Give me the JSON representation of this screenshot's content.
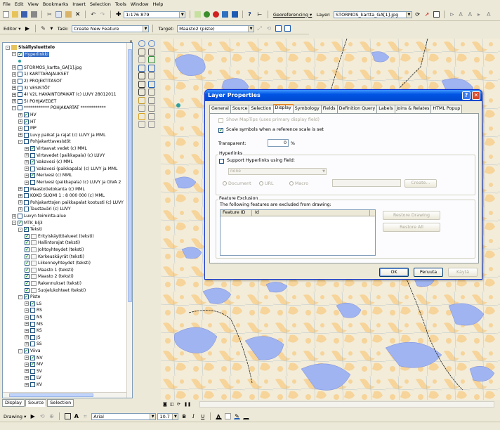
{
  "menu": [
    "File",
    "Edit",
    "View",
    "Bookmarks",
    "Insert",
    "Selection",
    "Tools",
    "Window",
    "Help"
  ],
  "toolbar1": {
    "scale_value": "1:176 879",
    "georeferencing_label": "Georeferencing ▾",
    "layer_label": "Layer:",
    "layer_value": "STORMOS_kartta_GA[1].jpg"
  },
  "editor_bar": {
    "editor_label": "Editor ▾",
    "task_label": "Task:",
    "task_value": "Create New Feature",
    "target_label": "Target:",
    "target_value": "Maasto2 (piste)"
  },
  "toc": {
    "items": [
      {
        "label": "Sisällysluettelo",
        "level": 0,
        "exp": "-",
        "chk": null,
        "bold": true
      },
      {
        "label": "Hyperlinkki",
        "level": 1,
        "exp": "-",
        "chk": true,
        "selected": true
      },
      {
        "label": "",
        "level": 2,
        "exp": null,
        "chk": null
      },
      {
        "label": "STORMOS_kartta_GA[1].jpg",
        "level": 1,
        "exp": "+",
        "chk": false
      },
      {
        "label": "1) KARTTARAJAUKSET",
        "level": 1,
        "exp": "+",
        "chk": false
      },
      {
        "label": "2) PROJEKTITASOT",
        "level": 1,
        "exp": "+",
        "chk": false
      },
      {
        "label": "3) VESISTÖT",
        "level": 1,
        "exp": "+",
        "chk": false
      },
      {
        "label": "4) V2L HAVAINTOPAIKAT (c) LUVY 28012011",
        "level": 1,
        "exp": "+",
        "chk": false
      },
      {
        "label": "5) POHJAVEDET",
        "level": 1,
        "exp": "+",
        "chk": false
      },
      {
        "label": "************ POHJAKARTAT ************",
        "level": 1,
        "exp": "-",
        "chk": false
      },
      {
        "label": "HV",
        "level": 2,
        "exp": "+",
        "chk": true
      },
      {
        "label": "HT",
        "level": 2,
        "exp": "+",
        "chk": true
      },
      {
        "label": "MP",
        "level": 2,
        "exp": "+",
        "chk": false
      },
      {
        "label": "Luvy paikat ja rajat (c) LUVY ja MML",
        "level": 2,
        "exp": "+",
        "chk": false
      },
      {
        "label": "Pohjakarttavesistöt",
        "level": 2,
        "exp": "-",
        "chk": false
      },
      {
        "label": "Virtaavat vedet (c) MML",
        "level": 3,
        "exp": "+",
        "chk": true
      },
      {
        "label": "Virtavedet (paikkapala) (c) LUVY",
        "level": 3,
        "exp": "+",
        "chk": false
      },
      {
        "label": "Vakavesi (c) MML",
        "level": 3,
        "exp": "+",
        "chk": true
      },
      {
        "label": "Vakavesi (paikkapala) (c) LUVY ja MML",
        "level": 3,
        "exp": "+",
        "chk": false
      },
      {
        "label": "Merivesi (c) MML",
        "level": 3,
        "exp": "+",
        "chk": true
      },
      {
        "label": "Merivesi (paikkapala) (c) LUVY ja OIVA 2",
        "level": 3,
        "exp": "+",
        "chk": false
      },
      {
        "label": "Maastotietokanta (c) MML",
        "level": 2,
        "exp": "+",
        "chk": false
      },
      {
        "label": "KOKO SUOMI 1 : 8 000 000 (c) MML",
        "level": 2,
        "exp": "+",
        "chk": false
      },
      {
        "label": "Pohjakarttojen paikkapalat kootusti (c) LUVY",
        "level": 2,
        "exp": "+",
        "chk": false
      },
      {
        "label": "Taustaväri (c) LUVY",
        "level": 2,
        "exp": "+",
        "chk": false
      },
      {
        "label": "Luvyn toiminta-alue",
        "level": 1,
        "exp": "+",
        "chk": false
      },
      {
        "label": "MTK_blj3",
        "level": 1,
        "exp": "-",
        "chk": true
      },
      {
        "label": "Teksti",
        "level": 2,
        "exp": "-",
        "chk": true
      },
      {
        "label": "Erityiskäyttöalueet (teksti)",
        "level": 3,
        "exp": null,
        "chk": true
      },
      {
        "label": "Hallintorajat (teksti)",
        "level": 3,
        "exp": null,
        "chk": true
      },
      {
        "label": "Johtoyhteydet (teksti)",
        "level": 3,
        "exp": null,
        "chk": true
      },
      {
        "label": "Korkeuskäyrät (teksti)",
        "level": 3,
        "exp": null,
        "chk": true
      },
      {
        "label": "Liikenneyhteydet (teksti)",
        "level": 3,
        "exp": null,
        "chk": true
      },
      {
        "label": "Maasto 1 (teksti)",
        "level": 3,
        "exp": null,
        "chk": true
      },
      {
        "label": "Maasto 2 (teksti)",
        "level": 3,
        "exp": null,
        "chk": true
      },
      {
        "label": "Rakennukset (teksti)",
        "level": 3,
        "exp": null,
        "chk": true
      },
      {
        "label": "Suojelukohteet (teksti)",
        "level": 3,
        "exp": null,
        "chk": true
      },
      {
        "label": "Piste",
        "level": 2,
        "exp": "-",
        "chk": true
      },
      {
        "label": "LS",
        "level": 3,
        "exp": "+",
        "chk": true
      },
      {
        "label": "RS",
        "level": 3,
        "exp": "+",
        "chk": false
      },
      {
        "label": "NS",
        "level": 3,
        "exp": "+",
        "chk": false
      },
      {
        "label": "MS",
        "level": 3,
        "exp": "+",
        "chk": false
      },
      {
        "label": "KS",
        "level": 3,
        "exp": "+",
        "chk": false
      },
      {
        "label": "JS",
        "level": 3,
        "exp": "+",
        "chk": false
      },
      {
        "label": "SS",
        "level": 3,
        "exp": "+",
        "chk": false
      },
      {
        "label": "Viiva",
        "level": 2,
        "exp": "-",
        "chk": true
      },
      {
        "label": "NV",
        "level": 3,
        "exp": "+",
        "chk": true
      },
      {
        "label": "MV",
        "level": 3,
        "exp": "+",
        "chk": true
      },
      {
        "label": "SV",
        "level": 3,
        "exp": "+",
        "chk": false
      },
      {
        "label": "LV",
        "level": 3,
        "exp": "+",
        "chk": false
      },
      {
        "label": "KV",
        "level": 3,
        "exp": "+",
        "chk": false
      }
    ],
    "tabs": [
      "Display",
      "Source",
      "Selection"
    ]
  },
  "dialog": {
    "title": "Layer Properties",
    "tabs": [
      "General",
      "Source",
      "Selection",
      "Display",
      "Symbology",
      "Fields",
      "Definition Query",
      "Labels",
      "Joins & Relates",
      "HTML Popup"
    ],
    "active_tab": "Display",
    "show_maptips": "Show MapTips (uses primary display field)",
    "scale_symbols": "Scale symbols when a reference scale is set",
    "transparent_label": "Transparent:",
    "transparent_value": "0",
    "transparent_unit": "%",
    "hyperlinks_group": "Hyperlinks",
    "support_hyperlinks": "Support Hyperlinks using field:",
    "field_value": "none",
    "radio_document": "Document",
    "radio_url": "URL",
    "radio_macro": "Macro",
    "create_button": "Create...",
    "feature_exclusion_group": "Feature Exclusion",
    "exclusion_desc": "The following features are excluded from drawing:",
    "col_feature_id": "Feature ID",
    "col_id": "Id",
    "restore_drawing": "Restore Drawing",
    "restore_all": "Restore All",
    "ok": "OK",
    "cancel": "Peruuta",
    "apply": "Käytä"
  },
  "drawing_bar": {
    "drawing_label": "Drawing ▾",
    "font_value": "Arial",
    "size_value": "10.7",
    "bold": "B",
    "italic": "I",
    "underline": "U",
    "font_color_glyph": "A"
  },
  "colors": {
    "map_land": "#f3ecd8",
    "map_sand": "#f6d49a",
    "map_water": "#9fb4f0",
    "map_grid": "#8aa8c6",
    "title_blue": "#0054e3"
  }
}
